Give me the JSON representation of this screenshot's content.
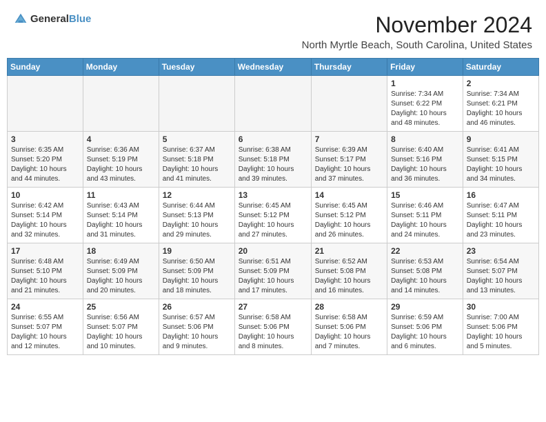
{
  "header": {
    "logo_general": "General",
    "logo_blue": "Blue",
    "month_title": "November 2024",
    "location": "North Myrtle Beach, South Carolina, United States"
  },
  "days_of_week": [
    "Sunday",
    "Monday",
    "Tuesday",
    "Wednesday",
    "Thursday",
    "Friday",
    "Saturday"
  ],
  "weeks": [
    [
      {
        "day": "",
        "info": ""
      },
      {
        "day": "",
        "info": ""
      },
      {
        "day": "",
        "info": ""
      },
      {
        "day": "",
        "info": ""
      },
      {
        "day": "",
        "info": ""
      },
      {
        "day": "1",
        "info": "Sunrise: 7:34 AM\nSunset: 6:22 PM\nDaylight: 10 hours and 48 minutes."
      },
      {
        "day": "2",
        "info": "Sunrise: 7:34 AM\nSunset: 6:21 PM\nDaylight: 10 hours and 46 minutes."
      }
    ],
    [
      {
        "day": "3",
        "info": "Sunrise: 6:35 AM\nSunset: 5:20 PM\nDaylight: 10 hours and 44 minutes."
      },
      {
        "day": "4",
        "info": "Sunrise: 6:36 AM\nSunset: 5:19 PM\nDaylight: 10 hours and 43 minutes."
      },
      {
        "day": "5",
        "info": "Sunrise: 6:37 AM\nSunset: 5:18 PM\nDaylight: 10 hours and 41 minutes."
      },
      {
        "day": "6",
        "info": "Sunrise: 6:38 AM\nSunset: 5:18 PM\nDaylight: 10 hours and 39 minutes."
      },
      {
        "day": "7",
        "info": "Sunrise: 6:39 AM\nSunset: 5:17 PM\nDaylight: 10 hours and 37 minutes."
      },
      {
        "day": "8",
        "info": "Sunrise: 6:40 AM\nSunset: 5:16 PM\nDaylight: 10 hours and 36 minutes."
      },
      {
        "day": "9",
        "info": "Sunrise: 6:41 AM\nSunset: 5:15 PM\nDaylight: 10 hours and 34 minutes."
      }
    ],
    [
      {
        "day": "10",
        "info": "Sunrise: 6:42 AM\nSunset: 5:14 PM\nDaylight: 10 hours and 32 minutes."
      },
      {
        "day": "11",
        "info": "Sunrise: 6:43 AM\nSunset: 5:14 PM\nDaylight: 10 hours and 31 minutes."
      },
      {
        "day": "12",
        "info": "Sunrise: 6:44 AM\nSunset: 5:13 PM\nDaylight: 10 hours and 29 minutes."
      },
      {
        "day": "13",
        "info": "Sunrise: 6:45 AM\nSunset: 5:12 PM\nDaylight: 10 hours and 27 minutes."
      },
      {
        "day": "14",
        "info": "Sunrise: 6:45 AM\nSunset: 5:12 PM\nDaylight: 10 hours and 26 minutes."
      },
      {
        "day": "15",
        "info": "Sunrise: 6:46 AM\nSunset: 5:11 PM\nDaylight: 10 hours and 24 minutes."
      },
      {
        "day": "16",
        "info": "Sunrise: 6:47 AM\nSunset: 5:11 PM\nDaylight: 10 hours and 23 minutes."
      }
    ],
    [
      {
        "day": "17",
        "info": "Sunrise: 6:48 AM\nSunset: 5:10 PM\nDaylight: 10 hours and 21 minutes."
      },
      {
        "day": "18",
        "info": "Sunrise: 6:49 AM\nSunset: 5:09 PM\nDaylight: 10 hours and 20 minutes."
      },
      {
        "day": "19",
        "info": "Sunrise: 6:50 AM\nSunset: 5:09 PM\nDaylight: 10 hours and 18 minutes."
      },
      {
        "day": "20",
        "info": "Sunrise: 6:51 AM\nSunset: 5:09 PM\nDaylight: 10 hours and 17 minutes."
      },
      {
        "day": "21",
        "info": "Sunrise: 6:52 AM\nSunset: 5:08 PM\nDaylight: 10 hours and 16 minutes."
      },
      {
        "day": "22",
        "info": "Sunrise: 6:53 AM\nSunset: 5:08 PM\nDaylight: 10 hours and 14 minutes."
      },
      {
        "day": "23",
        "info": "Sunrise: 6:54 AM\nSunset: 5:07 PM\nDaylight: 10 hours and 13 minutes."
      }
    ],
    [
      {
        "day": "24",
        "info": "Sunrise: 6:55 AM\nSunset: 5:07 PM\nDaylight: 10 hours and 12 minutes."
      },
      {
        "day": "25",
        "info": "Sunrise: 6:56 AM\nSunset: 5:07 PM\nDaylight: 10 hours and 10 minutes."
      },
      {
        "day": "26",
        "info": "Sunrise: 6:57 AM\nSunset: 5:06 PM\nDaylight: 10 hours and 9 minutes."
      },
      {
        "day": "27",
        "info": "Sunrise: 6:58 AM\nSunset: 5:06 PM\nDaylight: 10 hours and 8 minutes."
      },
      {
        "day": "28",
        "info": "Sunrise: 6:58 AM\nSunset: 5:06 PM\nDaylight: 10 hours and 7 minutes."
      },
      {
        "day": "29",
        "info": "Sunrise: 6:59 AM\nSunset: 5:06 PM\nDaylight: 10 hours and 6 minutes."
      },
      {
        "day": "30",
        "info": "Sunrise: 7:00 AM\nSunset: 5:06 PM\nDaylight: 10 hours and 5 minutes."
      }
    ]
  ]
}
